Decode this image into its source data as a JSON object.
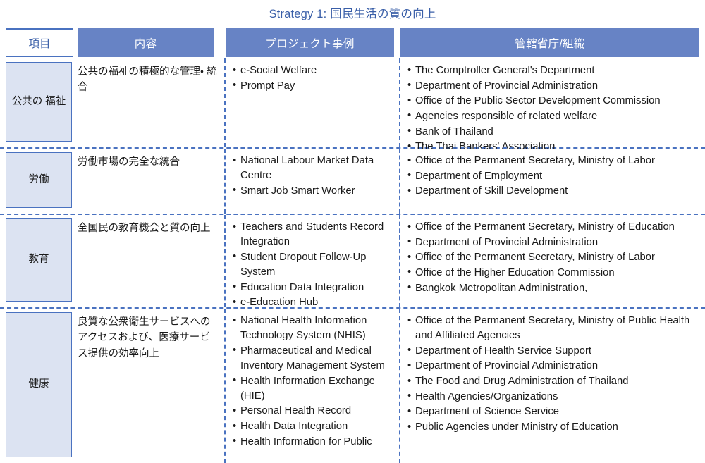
{
  "title": "Strategy 1: 国民生活の質の向上",
  "colors": {
    "header_fill": "#6783c5",
    "accent_blue": "#4a72c0",
    "title_text": "#3a5fa8",
    "label_box_fill": "#dce3f2",
    "body_text": "#1a1a1a"
  },
  "headers": {
    "item": "項目",
    "content": "内容",
    "project_examples": "プロジェクト事例",
    "agency": "管轄省庁/組織"
  },
  "rows": [
    {
      "label": "公共の\n福祉",
      "content": "公共の福祉の積極的な管理・ 統合",
      "projects": [
        "e-Social Welfare",
        "Prompt Pay"
      ],
      "agencies": [
        "The Comptroller General's Department",
        "Department of Provincial Administration",
        "Office of the Public Sector Development Commission",
        "Agencies responsible of related welfare",
        "Bank of Thailand",
        "The Thai Bankers' Association"
      ]
    },
    {
      "label": "労働",
      "content": "労働市場の完全な統合",
      "projects": [
        "National Labour Market Data Centre",
        "Smart Job Smart Worker"
      ],
      "agencies": [
        "Office of the Permanent Secretary, Ministry of Labor",
        "Department of Employment",
        "Department of Skill Development"
      ]
    },
    {
      "label": "教育",
      "content": "全国民の教育機会と質の向上",
      "projects": [
        "Teachers and Students Record Integration",
        "Student Dropout Follow-Up System",
        "Education Data Integration",
        "e-Education Hub"
      ],
      "agencies": [
        "Office of the Permanent Secretary, Ministry of Education",
        "Department of Provincial Administration",
        "Office of the Permanent Secretary, Ministry of Labor",
        "Office of the Higher Education Commission",
        "Bangkok Metropolitan Administration,"
      ]
    },
    {
      "label": "健康",
      "content": "良質な公衆衛生サービスへのアクセスおよび、医療サービス提供の効率向上",
      "projects": [
        "National Health Information Technology System (NHIS)",
        "Pharmaceutical and Medical Inventory Management System",
        "Health Information Exchange (HIE)",
        "Personal Health Record",
        "Health Data Integration",
        "Health Information for Public"
      ],
      "agencies": [
        "Office of the Permanent Secretary, Ministry of Public Health and Affiliated Agencies",
        "Department of Health Service Support",
        "Department of Provincial Administration",
        "The Food and Drug Administration of Thailand",
        "Health Agencies/Organizations",
        "Department of Science Service",
        "Public Agencies under Ministry of Education"
      ]
    }
  ]
}
